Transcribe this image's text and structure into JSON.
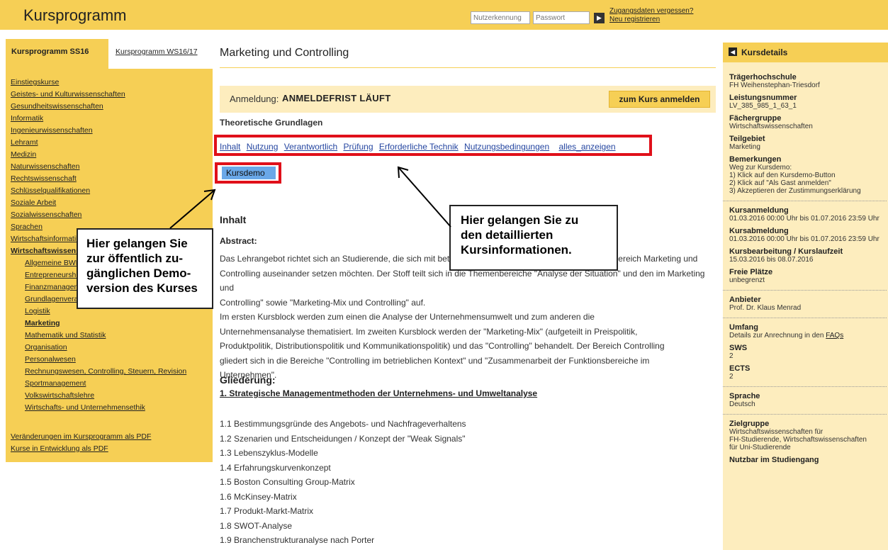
{
  "header": {
    "brand": "Kursprogramm",
    "username_placeholder": "Nutzerkennung",
    "password_placeholder": "Passwort",
    "forgot_link": "Zugangsdaten vergessen?",
    "register_link": "Neu registrieren"
  },
  "sidebar": {
    "tab_active": "Kursprogramm SS16",
    "tab_other": "Kursprogramm WS16/17",
    "items": [
      {
        "label": "Einstiegskurse"
      },
      {
        "label": "Geistes- und Kulturwissenschaften"
      },
      {
        "label": "Gesundheitswissenschaften"
      },
      {
        "label": "Informatik"
      },
      {
        "label": "Ingenieurwissenschaften"
      },
      {
        "label": "Lehramt"
      },
      {
        "label": "Medizin"
      },
      {
        "label": "Naturwissenschaften"
      },
      {
        "label": "Rechtswissenschaft"
      },
      {
        "label": "Schlüsselqualifikationen"
      },
      {
        "label": "Soziale Arbeit"
      },
      {
        "label": "Sozialwissenschaften"
      },
      {
        "label": "Sprachen"
      },
      {
        "label": "Wirtschaftsinformatik"
      },
      {
        "label": "Wirtschaftswissenschaften"
      }
    ],
    "subitems": [
      {
        "label": "Allgemeine BWL"
      },
      {
        "label": "Entrepreneurship"
      },
      {
        "label": "Finanzmanagement"
      },
      {
        "label": "Grundlagenveranstaltungen"
      },
      {
        "label": "Logistik"
      },
      {
        "label": "Marketing"
      },
      {
        "label": "Mathematik und Statistik"
      },
      {
        "label": "Organisation"
      },
      {
        "label": "Personalwesen"
      },
      {
        "label": "Rechnungswesen, Controlling, Steuern, Revision"
      },
      {
        "label": "Sportmanagement"
      },
      {
        "label": "Volkswirtschaftslehre"
      },
      {
        "label": "Wirtschafts- und Unternehmensethik"
      }
    ],
    "pdf_links": [
      {
        "label": "Veränderungen im Kursprogramm als PDF"
      },
      {
        "label": "Kurse in Entwicklung als PDF"
      }
    ]
  },
  "main": {
    "title": "Marketing und Controlling",
    "registration_label": "Anmeldung:",
    "registration_status": "ANMELDEFRIST LÄUFT",
    "register_button": "zum Kurs anmelden",
    "subtitle": "Theoretische Grundlagen",
    "tabs": [
      "Inhalt",
      "Nutzung",
      "Verantwortlich",
      "Prüfung",
      "Erforderliche Technik",
      "Nutzungsbedingungen",
      "alles_anzeigen"
    ],
    "demo_button": "Kursdemo",
    "content_heading": "Inhalt",
    "abstract_label": "Abstract:",
    "abstract_lines": [
      "Das Lehrangebot richtet sich an Studierende, die sich mit betriebswirtschaftlichen Problemstellungen im Bereich Marketing und",
      "Controlling auseinander setzen möchten. Der Stoff teilt sich in die Themenbereiche \"Analyse der Situation\" und den im Marketing und",
      "Controlling\" sowie \"Marketing-Mix und Controlling\" auf.",
      "Im ersten Kursblock werden zum einen die Analyse der Unternehmensumwelt und zum anderen die",
      "Unternehmensanalyse thematisiert. Im zweiten Kursblock werden der \"Marketing-Mix\" (aufgeteilt in Preispolitik,",
      "Produktpolitik, Distributionspolitik und Kommunikationspolitik) und das \"Controlling\" behandelt. Der Bereich Controlling",
      "gliedert sich in die Bereiche \"Controlling im betrieblichen Kontext\" und \"Zusammenarbeit der Funktionsbereiche im",
      "Unternehmen\"."
    ],
    "outline_heading": "Gliederung:",
    "outline_section": "1. Strategische Managementmethoden der Unternehmens- und Umweltanalyse",
    "outline_items": [
      "1.1 Bestimmungsgründe des Angebots- und Nachfrageverhaltens",
      "1.2 Szenarien und Entscheidungen / Konzept der \"Weak Signals\"",
      "1.3 Lebenszyklus-Modelle",
      "1.4 Erfahrungskurvenkonzept",
      "1.5 Boston Consulting Group-Matrix",
      "1.6 McKinsey-Matrix",
      "1.7 Produkt-Markt-Matrix",
      "1.8 SWOT-Analyse",
      "1.9 Branchenstrukturanalyse nach Porter"
    ]
  },
  "callouts": {
    "demo": [
      "Hier gelangen Sie",
      "zur öffentlich zu-",
      "gänglichen Demo-",
      "version des Kurses"
    ],
    "details": [
      "Hier gelangen Sie zu",
      "den detaillierten",
      "Kursinformationen."
    ]
  },
  "details": {
    "title": "Kursdetails",
    "traeger_label": "Trägerhochschule",
    "traeger_value": "FH Weihenstephan-Triesdorf",
    "leistung_label": "Leistungsnummer",
    "leistung_value": "LV_385_985_1_63_1",
    "faecher_label": "Fächergruppe",
    "faecher_value": "Wirtschaftswissenschaften",
    "teilgebiet_label": "Teilgebiet",
    "teilgebiet_value": "Marketing",
    "bemerk_label": "Bemerkungen",
    "bemerk_lines": [
      "Weg zur Kursdemo:",
      "1) Klick auf den Kursdemo-Button",
      "2) Klick auf \"Als Gast anmelden\"",
      "3) Akzeptieren der Zustimmungserklärung"
    ],
    "anm_label": "Kursanmeldung",
    "anm_value": "01.03.2016 00:00 Uhr bis 01.07.2016 23:59 Uhr",
    "abm_label": "Kursabmeldung",
    "abm_value": "01.03.2016 00:00 Uhr bis 01.07.2016 23:59 Uhr",
    "laufzeit_label": "Kursbearbeitung / Kurslaufzeit",
    "laufzeit_value": "15.03.2016 bis 08.07.2016",
    "plaetze_label": "Freie Plätze",
    "plaetze_value": "unbegrenzt",
    "anbieter_label": "Anbieter",
    "anbieter_value": "Prof. Dr. Klaus Menrad",
    "umfang_label": "Umfang",
    "umfang_value": "Details zur Anrechnung in den",
    "umfang_link": "FAQs",
    "sws_label": "SWS",
    "sws_value": "2",
    "ects_label": "ECTS",
    "ects_value": "2",
    "sprache_label": "Sprache",
    "sprache_value": "Deutsch",
    "ziel_label": "Zielgruppe",
    "ziel_lines": [
      "Wirtschaftswissenschaften für",
      "FH-Studierende, Wirtschaftswissenschaften",
      "für Uni-Studierende"
    ],
    "nutzbar_label": "Nutzbar im Studiengang"
  }
}
